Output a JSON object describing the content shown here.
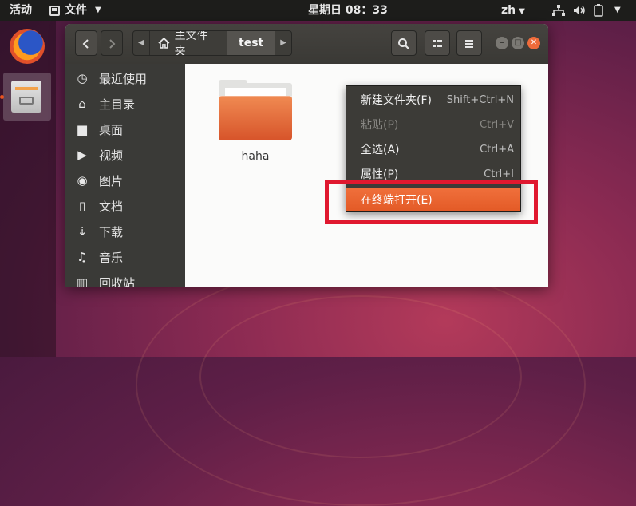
{
  "topbar": {
    "activities": "活动",
    "app_menu": "文件",
    "clock": "星期日 08：33",
    "input_method": "zh"
  },
  "dock": {
    "apps": [
      {
        "name": "firefox-icon"
      },
      {
        "name": "files-icon",
        "running": true
      }
    ]
  },
  "window": {
    "breadcrumb": {
      "home": "主文件夹",
      "current": "test"
    },
    "sidebar": {
      "items": [
        {
          "label": "最近使用",
          "icon": "clock-icon"
        },
        {
          "label": "主目录",
          "icon": "home-icon"
        },
        {
          "label": "桌面",
          "icon": "folder-icon"
        },
        {
          "label": "视频",
          "icon": "video-icon"
        },
        {
          "label": "图片",
          "icon": "camera-icon"
        },
        {
          "label": "文档",
          "icon": "document-icon"
        },
        {
          "label": "下载",
          "icon": "download-icon"
        },
        {
          "label": "音乐",
          "icon": "music-icon"
        },
        {
          "label": "回收站",
          "icon": "trash-icon"
        }
      ]
    },
    "files": [
      {
        "name": "haha",
        "type": "folder"
      }
    ]
  },
  "context_menu": {
    "items": [
      {
        "label": "新建文件夹(F)",
        "shortcut": "Shift+Ctrl+N",
        "enabled": true
      },
      {
        "label": "粘贴(P)",
        "shortcut": "Ctrl+V",
        "enabled": false
      },
      {
        "label": "全选(A)",
        "shortcut": "Ctrl+A",
        "enabled": true
      },
      {
        "label": "属性(P)",
        "shortcut": "Ctrl+I",
        "enabled": true
      },
      {
        "label": "在终端打开(E)",
        "shortcut": "",
        "enabled": true,
        "highlighted": true
      }
    ]
  },
  "colors": {
    "accent": "#e95420",
    "annotation_box": "#e0182f"
  }
}
